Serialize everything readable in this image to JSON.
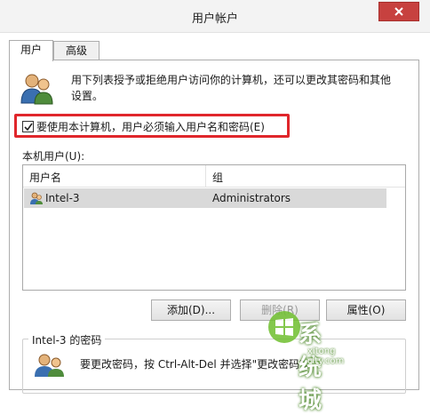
{
  "window": {
    "title": "用户帐户"
  },
  "tabs": [
    {
      "label": "用户"
    },
    {
      "label": "高级"
    }
  ],
  "description": {
    "line1": "用下列表授予或拒绝用户访问你的计算机，还可以更改其密码和其他",
    "line2": "设置。"
  },
  "require_login": {
    "label": "要使用本计算机，用户必须输入用户名和密码(E)",
    "checked": true
  },
  "local_users": {
    "label": "本机用户(U):",
    "columns": [
      "用户名",
      "组"
    ],
    "rows": [
      {
        "name": "Intel-3",
        "group": "Administrators"
      }
    ]
  },
  "buttons": {
    "add": "添加(D)...",
    "remove": "删除(R)",
    "properties": "属性(O)"
  },
  "password_group": {
    "title": "Intel-3 的密码",
    "text": "要更改密码，按 Ctrl-Alt-Del 并选择\"更改密码\"。"
  },
  "watermark": {
    "brand": "系统城",
    "url": "xitong city.com"
  },
  "colors": {
    "highlight": "#e0262b",
    "close": "#c7413f",
    "watermark_green": "#6fbf2e"
  }
}
